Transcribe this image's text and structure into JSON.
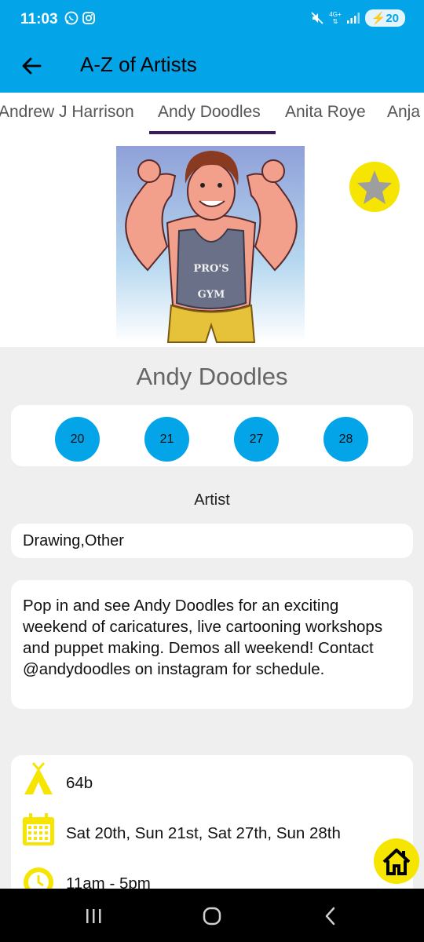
{
  "status_bar": {
    "time": "11:03",
    "left_icons": [
      "whatsapp-icon",
      "instagram-icon"
    ],
    "right_icons": [
      "mute-icon",
      "network-4g-icon",
      "signal-icon"
    ],
    "network": "4G+",
    "battery": "20"
  },
  "app_bar": {
    "title": "A-Z of Artists",
    "back_icon": "arrow-left-icon"
  },
  "tabs": [
    {
      "label": "Andrew J Harrison",
      "selected": false
    },
    {
      "label": "Andy Doodles",
      "selected": true
    },
    {
      "label": "Anita Roye",
      "selected": false
    },
    {
      "label": "Anja",
      "selected": false
    }
  ],
  "artist": {
    "name": "Andy Doodles",
    "image": "caricature of muscleman in Pro's Gym vest",
    "image_text": [
      "PRO'S",
      "GYM"
    ],
    "favorite_icon": "star-icon",
    "role": "Artist",
    "dates": [
      "20",
      "21",
      "27",
      "28"
    ],
    "categories": "Drawing,Other",
    "description": "Pop in and see Andy Doodles for an exciting weekend of caricatures, live cartooning workshops and puppet making. Demos all weekend! Contact @andydoodles on instagram for schedule.",
    "info": [
      {
        "icon": "tent-icon",
        "text": "64b"
      },
      {
        "icon": "calendar-icon",
        "text": "Sat 20th, Sun 21st, Sat 27th, Sun 28th"
      },
      {
        "icon": "clock-icon",
        "text": "11am - 5pm"
      }
    ]
  },
  "fab": {
    "icon": "home-icon"
  },
  "nav_bar": {
    "icons": [
      "recents-icon",
      "home-nav-icon",
      "back-nav-icon"
    ]
  },
  "colors": {
    "primary": "#03a4e8",
    "accent_yellow": "#f6e500",
    "tab_indicator": "#3a1b5d",
    "background": "#efefef"
  }
}
